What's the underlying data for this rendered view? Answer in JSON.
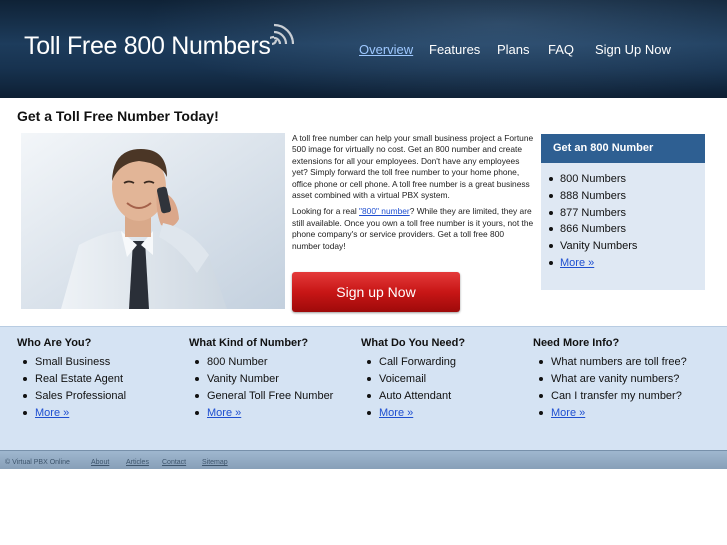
{
  "header": {
    "logo_text": "Toll Free 800 Numbers",
    "nav": [
      {
        "label": "Overview",
        "active": true
      },
      {
        "label": "Features"
      },
      {
        "label": "Plans"
      },
      {
        "label": "FAQ"
      },
      {
        "label": "Sign Up Now"
      }
    ]
  },
  "main": {
    "headline": "Get a Toll Free Number Today!",
    "paragraph1": "A toll free number can help your small business project a Fortune 500 image for virtually no cost. Get an 800 number and create extensions for all your employees. Don't have any employees yet? Simply forward the toll free number to your home phone, office phone or cell phone. A toll free number is a great business asset combined with a virtual PBX system.",
    "paragraph2_before": "Looking for a real ",
    "paragraph2_link": "\"800\" number",
    "paragraph2_after": "? While they are limited, they are still available. Once you own a toll free number is it yours, not the phone company's or service providers. Get a toll free 800 number today!",
    "signup_button": "Sign up Now"
  },
  "get_number_box": {
    "title": "Get an 800 Number",
    "items": [
      "800 Numbers",
      "888 Numbers",
      "877 Numbers",
      "866 Numbers",
      "Vanity Numbers"
    ],
    "more": "More »"
  },
  "columns": [
    {
      "title": "Who Are You?",
      "items": [
        "Small Business",
        "Real Estate Agent",
        "Sales Professional"
      ],
      "more": "More »"
    },
    {
      "title": "What Kind of Number?",
      "items": [
        "800 Number",
        "Vanity Number",
        "General Toll Free Number"
      ],
      "more": "More »"
    },
    {
      "title": "What Do You Need?",
      "items": [
        "Call Forwarding",
        "Voicemail",
        "Auto Attendant"
      ],
      "more": "More »"
    },
    {
      "title": "Need More Info?",
      "items": [
        "What numbers are toll free?",
        "What are vanity numbers?",
        "Can I transfer my number?"
      ],
      "more": "More »"
    }
  ],
  "footer": {
    "copyright": "© Virtual PBX Online",
    "links": [
      "About",
      "Articles",
      "Contact",
      "Sitemap"
    ]
  },
  "colors": {
    "header_bg": "#17324f",
    "nav_active": "#9ec8ff",
    "link": "#1f4fd0",
    "box_title_bg": "#2e5f92",
    "box_bg": "#dfe8f3",
    "band_bg": "#d5e3f3",
    "button_red": "#c81616"
  }
}
